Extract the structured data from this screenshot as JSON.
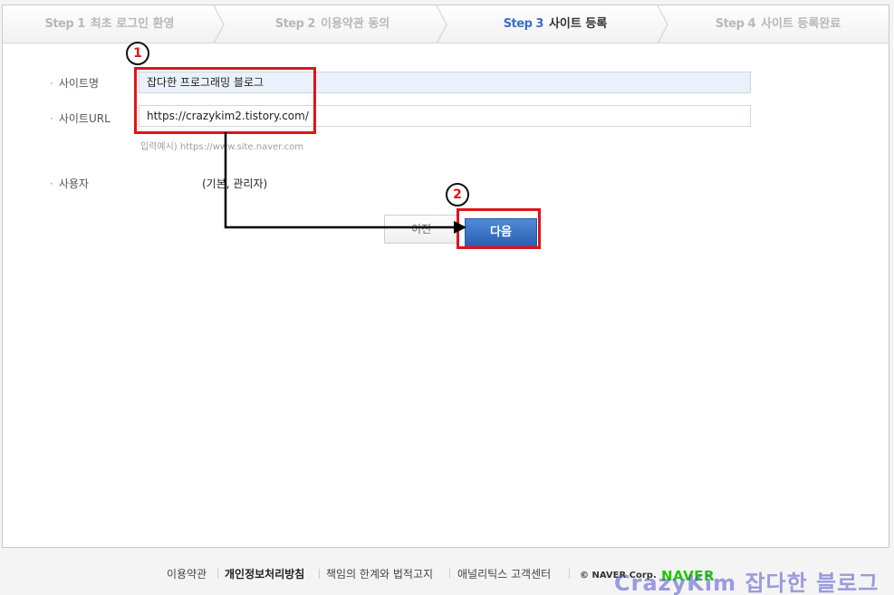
{
  "steps": [
    {
      "num": "Step 1",
      "label": "최초 로그인 환영",
      "active": false
    },
    {
      "num": "Step 2",
      "label": "이용약관 동의",
      "active": false
    },
    {
      "num": "Step 3",
      "label": "사이트 등록",
      "active": true
    },
    {
      "num": "Step 4",
      "label": "사이트 등록완료",
      "active": false
    }
  ],
  "form": {
    "site_name_label": "사이트명",
    "site_name_value": "잡다한 프로그래밍 블로그",
    "site_url_label": "사이트URL",
    "site_url_value": "https://crazykim2.tistory.com/",
    "url_hint": "입력예시) https://www.site.naver.com",
    "user_label": "사용자",
    "user_value": "(기본, 관리자)"
  },
  "buttons": {
    "prev": "이전",
    "next": "다음"
  },
  "annotations": {
    "badge1": "1",
    "badge2": "2",
    "highlight_color": "#e0141a"
  },
  "footer": {
    "links": [
      "이용약관",
      "개인정보처리방침",
      "책임의 한계와 법적고지",
      "애널리틱스 고객센터"
    ],
    "corp": "© NAVER Corp.",
    "brand": "NAVER",
    "watermark": "CrazyKim 잡다한 블로그"
  },
  "colors": {
    "accent": "#3c6fc4",
    "button_blue": "#2b5fb0",
    "naver_green": "#1ec800"
  }
}
